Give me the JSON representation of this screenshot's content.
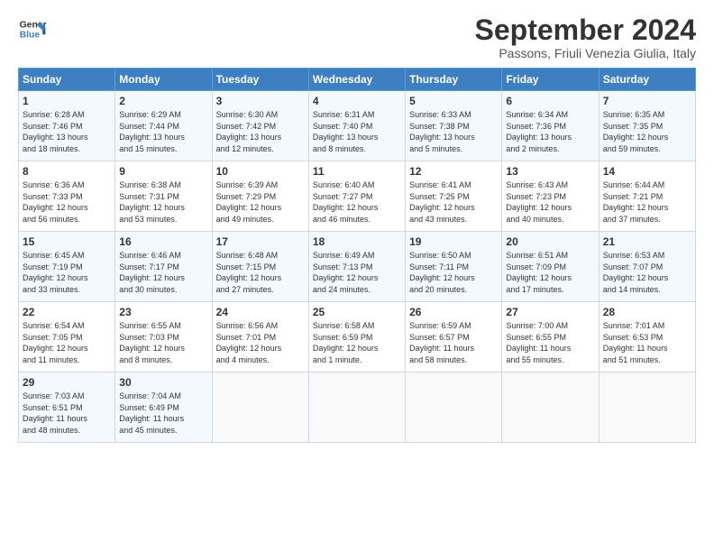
{
  "header": {
    "logo_line1": "General",
    "logo_line2": "Blue",
    "month_title": "September 2024",
    "subtitle": "Passons, Friuli Venezia Giulia, Italy"
  },
  "days_of_week": [
    "Sunday",
    "Monday",
    "Tuesday",
    "Wednesday",
    "Thursday",
    "Friday",
    "Saturday"
  ],
  "weeks": [
    [
      {
        "day": "1",
        "lines": [
          "Sunrise: 6:28 AM",
          "Sunset: 7:46 PM",
          "Daylight: 13 hours",
          "and 18 minutes."
        ]
      },
      {
        "day": "2",
        "lines": [
          "Sunrise: 6:29 AM",
          "Sunset: 7:44 PM",
          "Daylight: 13 hours",
          "and 15 minutes."
        ]
      },
      {
        "day": "3",
        "lines": [
          "Sunrise: 6:30 AM",
          "Sunset: 7:42 PM",
          "Daylight: 13 hours",
          "and 12 minutes."
        ]
      },
      {
        "day": "4",
        "lines": [
          "Sunrise: 6:31 AM",
          "Sunset: 7:40 PM",
          "Daylight: 13 hours",
          "and 8 minutes."
        ]
      },
      {
        "day": "5",
        "lines": [
          "Sunrise: 6:33 AM",
          "Sunset: 7:38 PM",
          "Daylight: 13 hours",
          "and 5 minutes."
        ]
      },
      {
        "day": "6",
        "lines": [
          "Sunrise: 6:34 AM",
          "Sunset: 7:36 PM",
          "Daylight: 13 hours",
          "and 2 minutes."
        ]
      },
      {
        "day": "7",
        "lines": [
          "Sunrise: 6:35 AM",
          "Sunset: 7:35 PM",
          "Daylight: 12 hours",
          "and 59 minutes."
        ]
      }
    ],
    [
      {
        "day": "8",
        "lines": [
          "Sunrise: 6:36 AM",
          "Sunset: 7:33 PM",
          "Daylight: 12 hours",
          "and 56 minutes."
        ]
      },
      {
        "day": "9",
        "lines": [
          "Sunrise: 6:38 AM",
          "Sunset: 7:31 PM",
          "Daylight: 12 hours",
          "and 53 minutes."
        ]
      },
      {
        "day": "10",
        "lines": [
          "Sunrise: 6:39 AM",
          "Sunset: 7:29 PM",
          "Daylight: 12 hours",
          "and 49 minutes."
        ]
      },
      {
        "day": "11",
        "lines": [
          "Sunrise: 6:40 AM",
          "Sunset: 7:27 PM",
          "Daylight: 12 hours",
          "and 46 minutes."
        ]
      },
      {
        "day": "12",
        "lines": [
          "Sunrise: 6:41 AM",
          "Sunset: 7:25 PM",
          "Daylight: 12 hours",
          "and 43 minutes."
        ]
      },
      {
        "day": "13",
        "lines": [
          "Sunrise: 6:43 AM",
          "Sunset: 7:23 PM",
          "Daylight: 12 hours",
          "and 40 minutes."
        ]
      },
      {
        "day": "14",
        "lines": [
          "Sunrise: 6:44 AM",
          "Sunset: 7:21 PM",
          "Daylight: 12 hours",
          "and 37 minutes."
        ]
      }
    ],
    [
      {
        "day": "15",
        "lines": [
          "Sunrise: 6:45 AM",
          "Sunset: 7:19 PM",
          "Daylight: 12 hours",
          "and 33 minutes."
        ]
      },
      {
        "day": "16",
        "lines": [
          "Sunrise: 6:46 AM",
          "Sunset: 7:17 PM",
          "Daylight: 12 hours",
          "and 30 minutes."
        ]
      },
      {
        "day": "17",
        "lines": [
          "Sunrise: 6:48 AM",
          "Sunset: 7:15 PM",
          "Daylight: 12 hours",
          "and 27 minutes."
        ]
      },
      {
        "day": "18",
        "lines": [
          "Sunrise: 6:49 AM",
          "Sunset: 7:13 PM",
          "Daylight: 12 hours",
          "and 24 minutes."
        ]
      },
      {
        "day": "19",
        "lines": [
          "Sunrise: 6:50 AM",
          "Sunset: 7:11 PM",
          "Daylight: 12 hours",
          "and 20 minutes."
        ]
      },
      {
        "day": "20",
        "lines": [
          "Sunrise: 6:51 AM",
          "Sunset: 7:09 PM",
          "Daylight: 12 hours",
          "and 17 minutes."
        ]
      },
      {
        "day": "21",
        "lines": [
          "Sunrise: 6:53 AM",
          "Sunset: 7:07 PM",
          "Daylight: 12 hours",
          "and 14 minutes."
        ]
      }
    ],
    [
      {
        "day": "22",
        "lines": [
          "Sunrise: 6:54 AM",
          "Sunset: 7:05 PM",
          "Daylight: 12 hours",
          "and 11 minutes."
        ]
      },
      {
        "day": "23",
        "lines": [
          "Sunrise: 6:55 AM",
          "Sunset: 7:03 PM",
          "Daylight: 12 hours",
          "and 8 minutes."
        ]
      },
      {
        "day": "24",
        "lines": [
          "Sunrise: 6:56 AM",
          "Sunset: 7:01 PM",
          "Daylight: 12 hours",
          "and 4 minutes."
        ]
      },
      {
        "day": "25",
        "lines": [
          "Sunrise: 6:58 AM",
          "Sunset: 6:59 PM",
          "Daylight: 12 hours",
          "and 1 minute."
        ]
      },
      {
        "day": "26",
        "lines": [
          "Sunrise: 6:59 AM",
          "Sunset: 6:57 PM",
          "Daylight: 11 hours",
          "and 58 minutes."
        ]
      },
      {
        "day": "27",
        "lines": [
          "Sunrise: 7:00 AM",
          "Sunset: 6:55 PM",
          "Daylight: 11 hours",
          "and 55 minutes."
        ]
      },
      {
        "day": "28",
        "lines": [
          "Sunrise: 7:01 AM",
          "Sunset: 6:53 PM",
          "Daylight: 11 hours",
          "and 51 minutes."
        ]
      }
    ],
    [
      {
        "day": "29",
        "lines": [
          "Sunrise: 7:03 AM",
          "Sunset: 6:51 PM",
          "Daylight: 11 hours",
          "and 48 minutes."
        ]
      },
      {
        "day": "30",
        "lines": [
          "Sunrise: 7:04 AM",
          "Sunset: 6:49 PM",
          "Daylight: 11 hours",
          "and 45 minutes."
        ]
      },
      {
        "day": "",
        "lines": []
      },
      {
        "day": "",
        "lines": []
      },
      {
        "day": "",
        "lines": []
      },
      {
        "day": "",
        "lines": []
      },
      {
        "day": "",
        "lines": []
      }
    ]
  ]
}
